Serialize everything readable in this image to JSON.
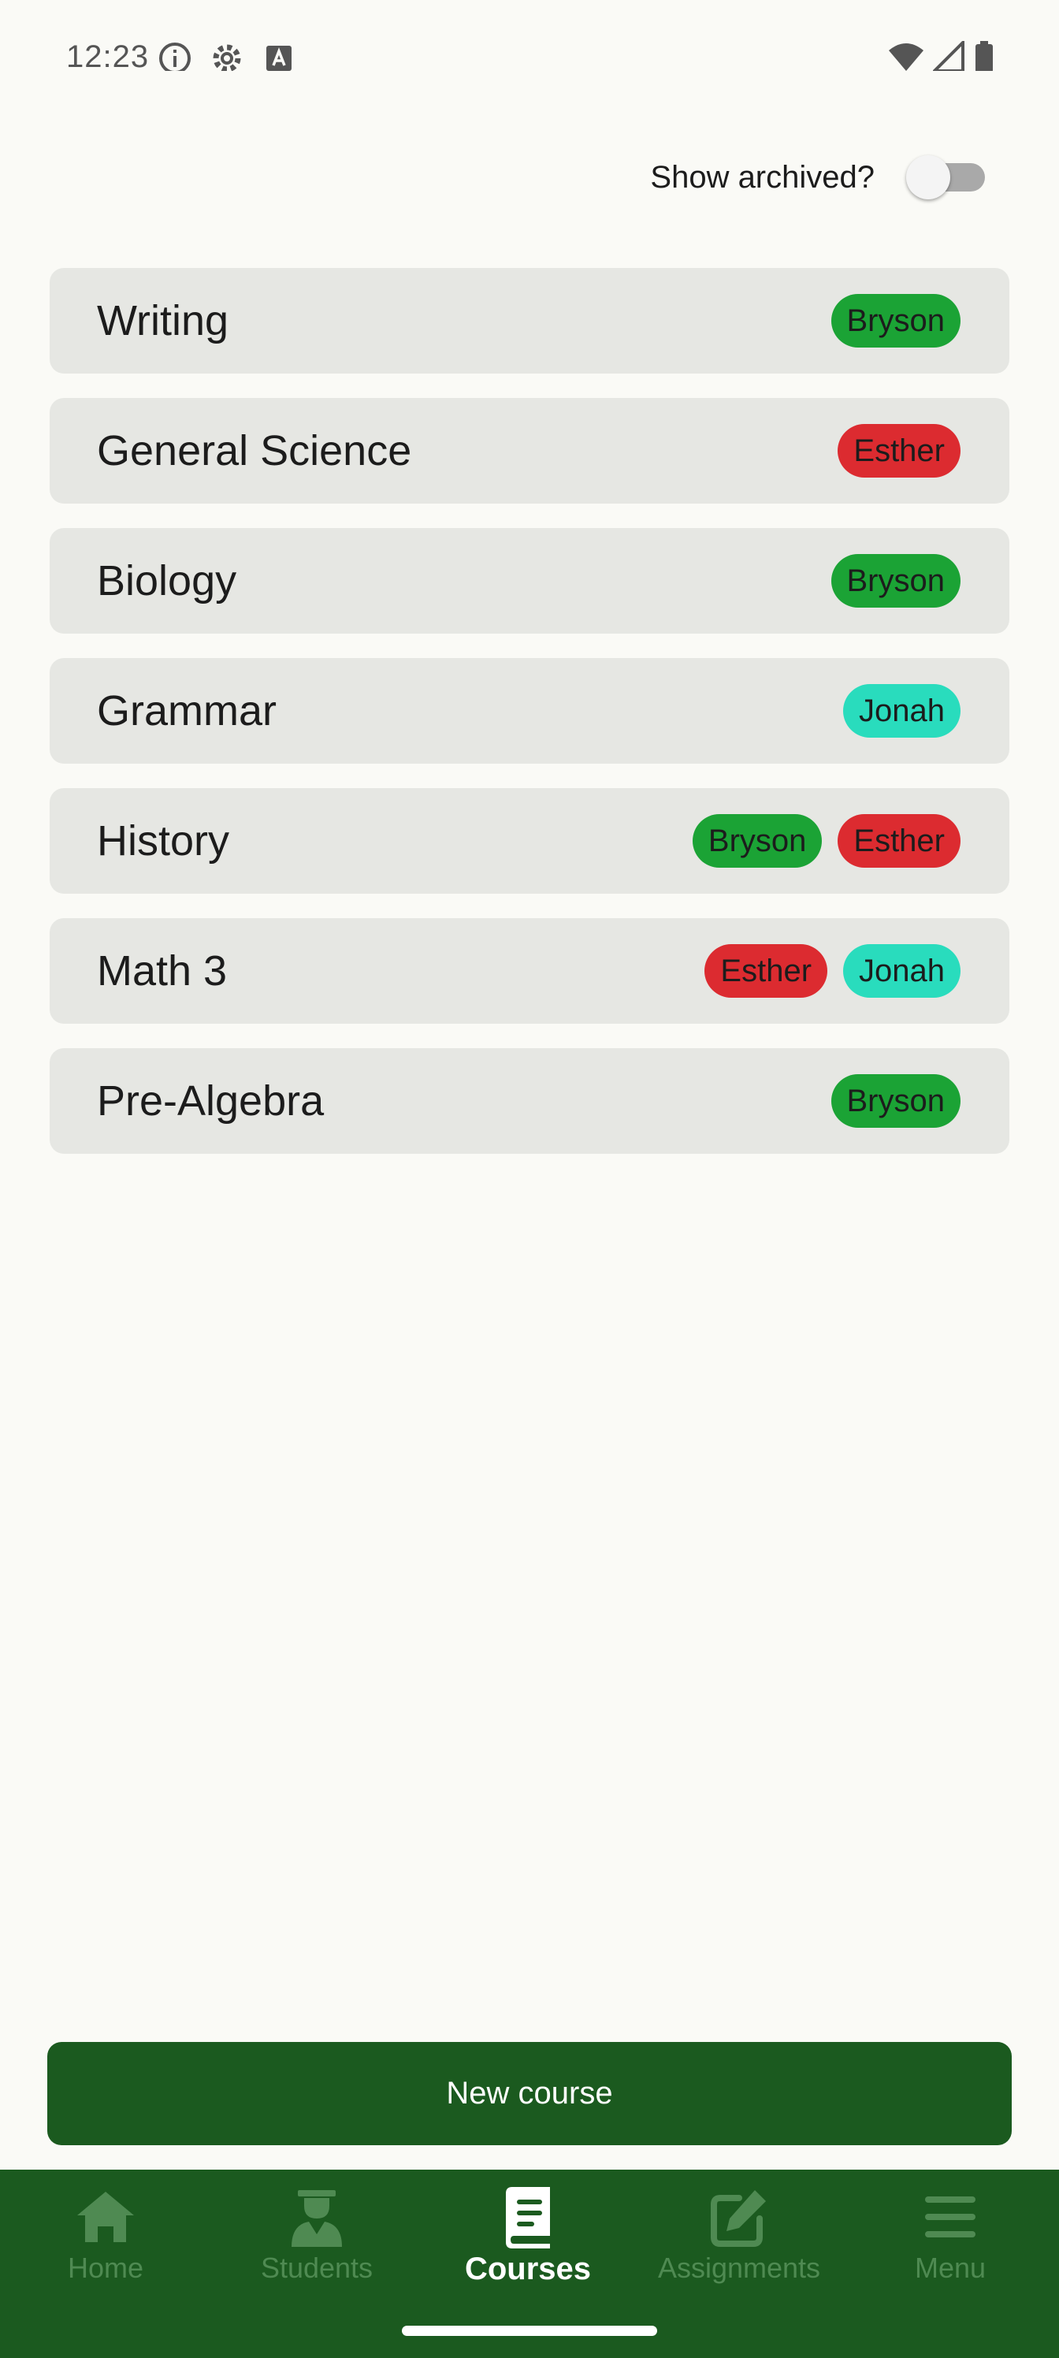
{
  "status_bar": {
    "time": "12:23"
  },
  "archive_toggle": {
    "label": "Show archived?",
    "checked": false
  },
  "colors": {
    "background": "#fafaf6",
    "card": "#e6e7e3",
    "primary": "#1b5a1f",
    "nav_inactive": "#4f8a52",
    "student_Bryson": "#1ba335",
    "student_Esther": "#dc2b30",
    "student_Jonah": "#29dcbd"
  },
  "courses": [
    {
      "name": "Writing",
      "students": [
        {
          "name": "Bryson",
          "color": "#1ba335"
        }
      ]
    },
    {
      "name": "General Science",
      "students": [
        {
          "name": "Esther",
          "color": "#dc2b30"
        }
      ]
    },
    {
      "name": "Biology",
      "students": [
        {
          "name": "Bryson",
          "color": "#1ba335"
        }
      ]
    },
    {
      "name": "Grammar",
      "students": [
        {
          "name": "Jonah",
          "color": "#29dcbd"
        }
      ]
    },
    {
      "name": "History",
      "students": [
        {
          "name": "Bryson",
          "color": "#1ba335"
        },
        {
          "name": "Esther",
          "color": "#dc2b30"
        }
      ]
    },
    {
      "name": "Math 3",
      "students": [
        {
          "name": "Esther",
          "color": "#dc2b30"
        },
        {
          "name": "Jonah",
          "color": "#29dcbd"
        }
      ]
    },
    {
      "name": "Pre-Algebra",
      "students": [
        {
          "name": "Bryson",
          "color": "#1ba335"
        }
      ]
    }
  ],
  "new_course_button": {
    "label": "New course"
  },
  "nav": {
    "active": "Courses",
    "items": [
      {
        "label": "Home",
        "icon": "home-icon"
      },
      {
        "label": "Students",
        "icon": "student-icon"
      },
      {
        "label": "Courses",
        "icon": "book-icon"
      },
      {
        "label": "Assignments",
        "icon": "edit-icon"
      },
      {
        "label": "Menu",
        "icon": "menu-icon"
      }
    ]
  }
}
